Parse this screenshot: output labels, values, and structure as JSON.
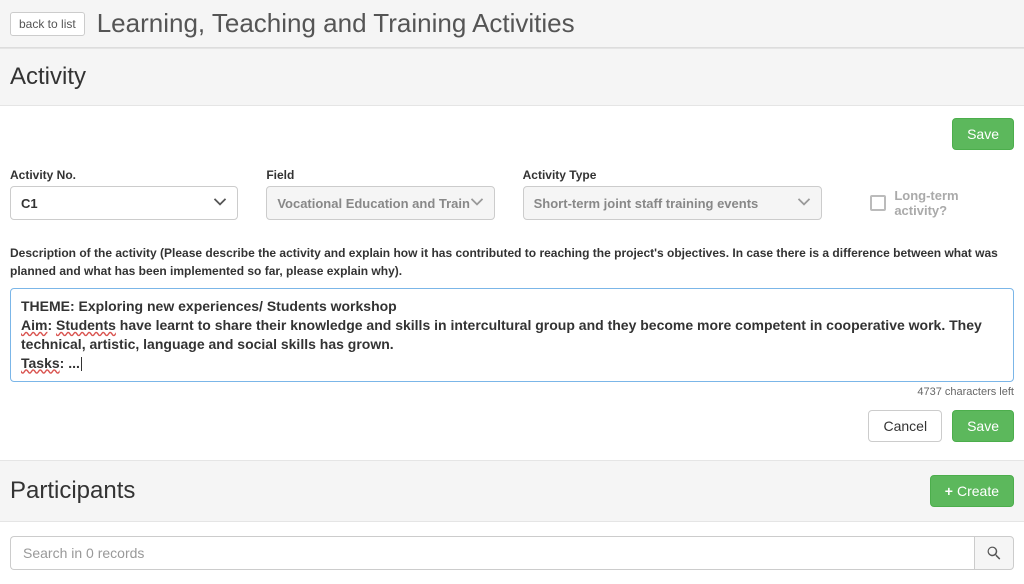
{
  "header": {
    "back_label": "back to list",
    "page_title": "Learning, Teaching and Training Activities"
  },
  "activity": {
    "section_title": "Activity",
    "save_label": "Save",
    "cancel_label": "Cancel",
    "fields": {
      "activity_no": {
        "label": "Activity No.",
        "value": "C1"
      },
      "field": {
        "label": "Field",
        "value": "Vocational Education and Train"
      },
      "activity_type": {
        "label": "Activity Type",
        "value": "Short-term joint staff training events"
      },
      "long_term": {
        "label": "Long-term activity?",
        "checked": false
      }
    },
    "description": {
      "label": "Description of the activity (Please describe the activity and explain how it has contributed to reaching the project's objectives. In case there is a difference between what was planned and what has been implemented so far, please explain why).",
      "text_theme": "THEME: Exploring new experiences/ Students workshop",
      "text_aim_label": "Aim",
      "text_aim_sep": ": ",
      "text_aim_students": "Students",
      "text_aim_body": " have learnt to share their knowledge and skills in intercultural group and they become more competent in cooperative work. They technical, artistic, language and social skills has grown.",
      "text_tasks_label": "Tasks",
      "text_tasks_body": ": ...",
      "chars_left": "4737 characters left"
    }
  },
  "participants": {
    "section_title": "Participants",
    "create_label": "Create",
    "search_placeholder": "Search in 0 records"
  }
}
